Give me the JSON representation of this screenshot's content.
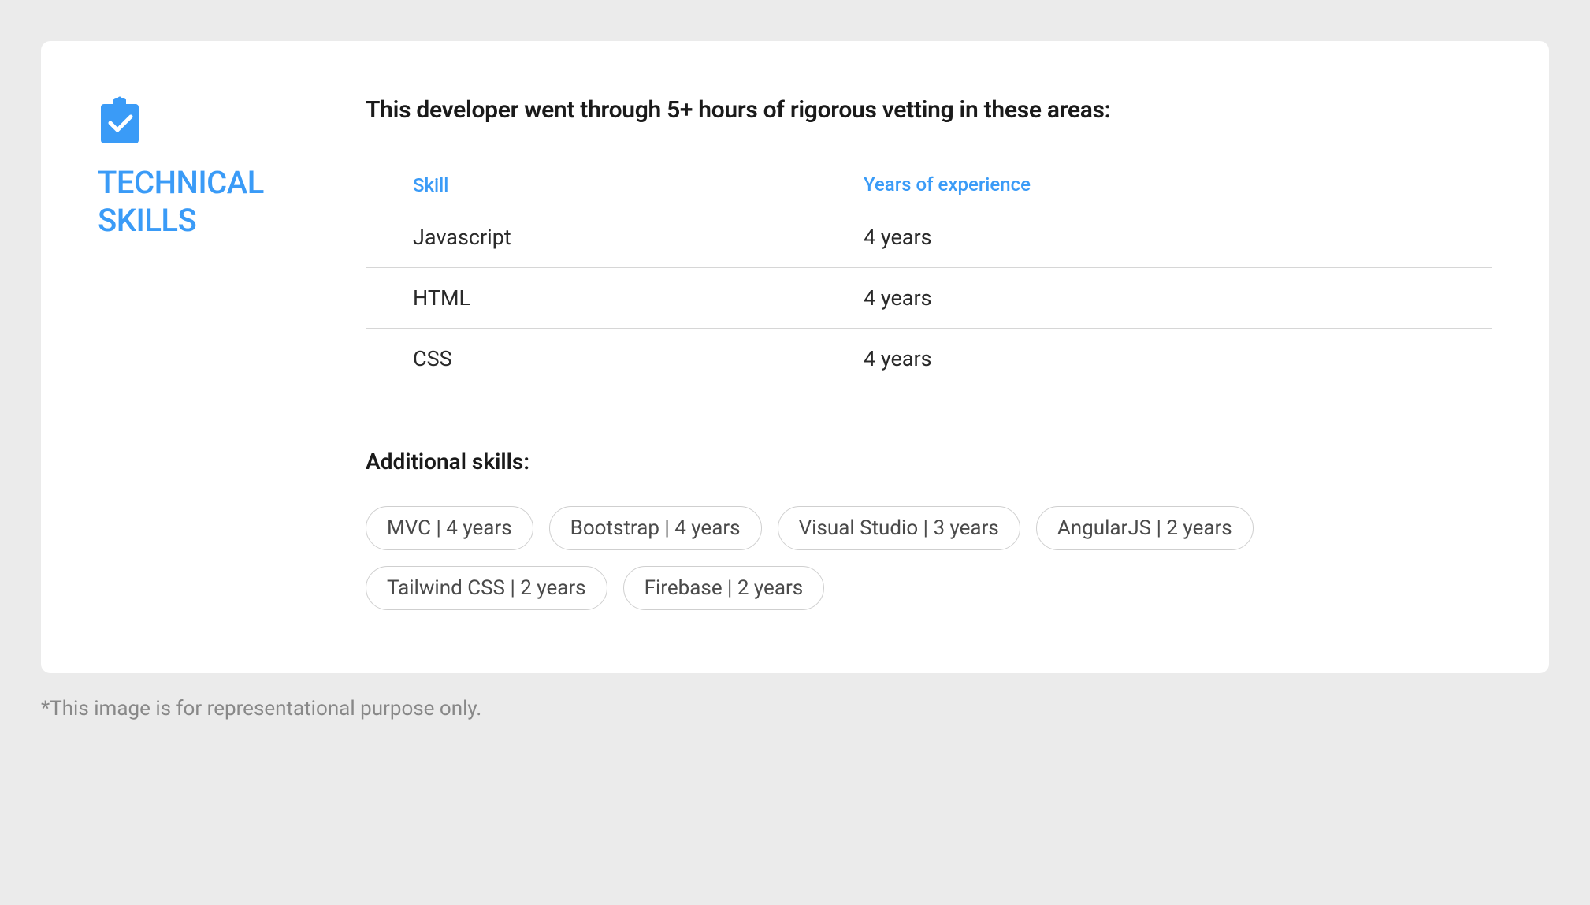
{
  "section": {
    "title": "TECHNICAL SKILLS"
  },
  "intro": "This developer went through 5+ hours of rigorous vetting in these areas:",
  "table": {
    "headers": {
      "skill": "Skill",
      "experience": "Years of experience"
    },
    "rows": [
      {
        "skill": "Javascript",
        "experience": "4 years"
      },
      {
        "skill": "HTML",
        "experience": "4 years"
      },
      {
        "skill": "CSS",
        "experience": "4 years"
      }
    ]
  },
  "additional": {
    "title": "Additional skills:",
    "pills": [
      "MVC | 4 years",
      "Bootstrap | 4 years",
      "Visual Studio | 3 years",
      "AngularJS | 2 years",
      "Tailwind CSS | 2 years",
      "Firebase | 2 years"
    ]
  },
  "disclaimer": "*This image is for representational purpose only."
}
